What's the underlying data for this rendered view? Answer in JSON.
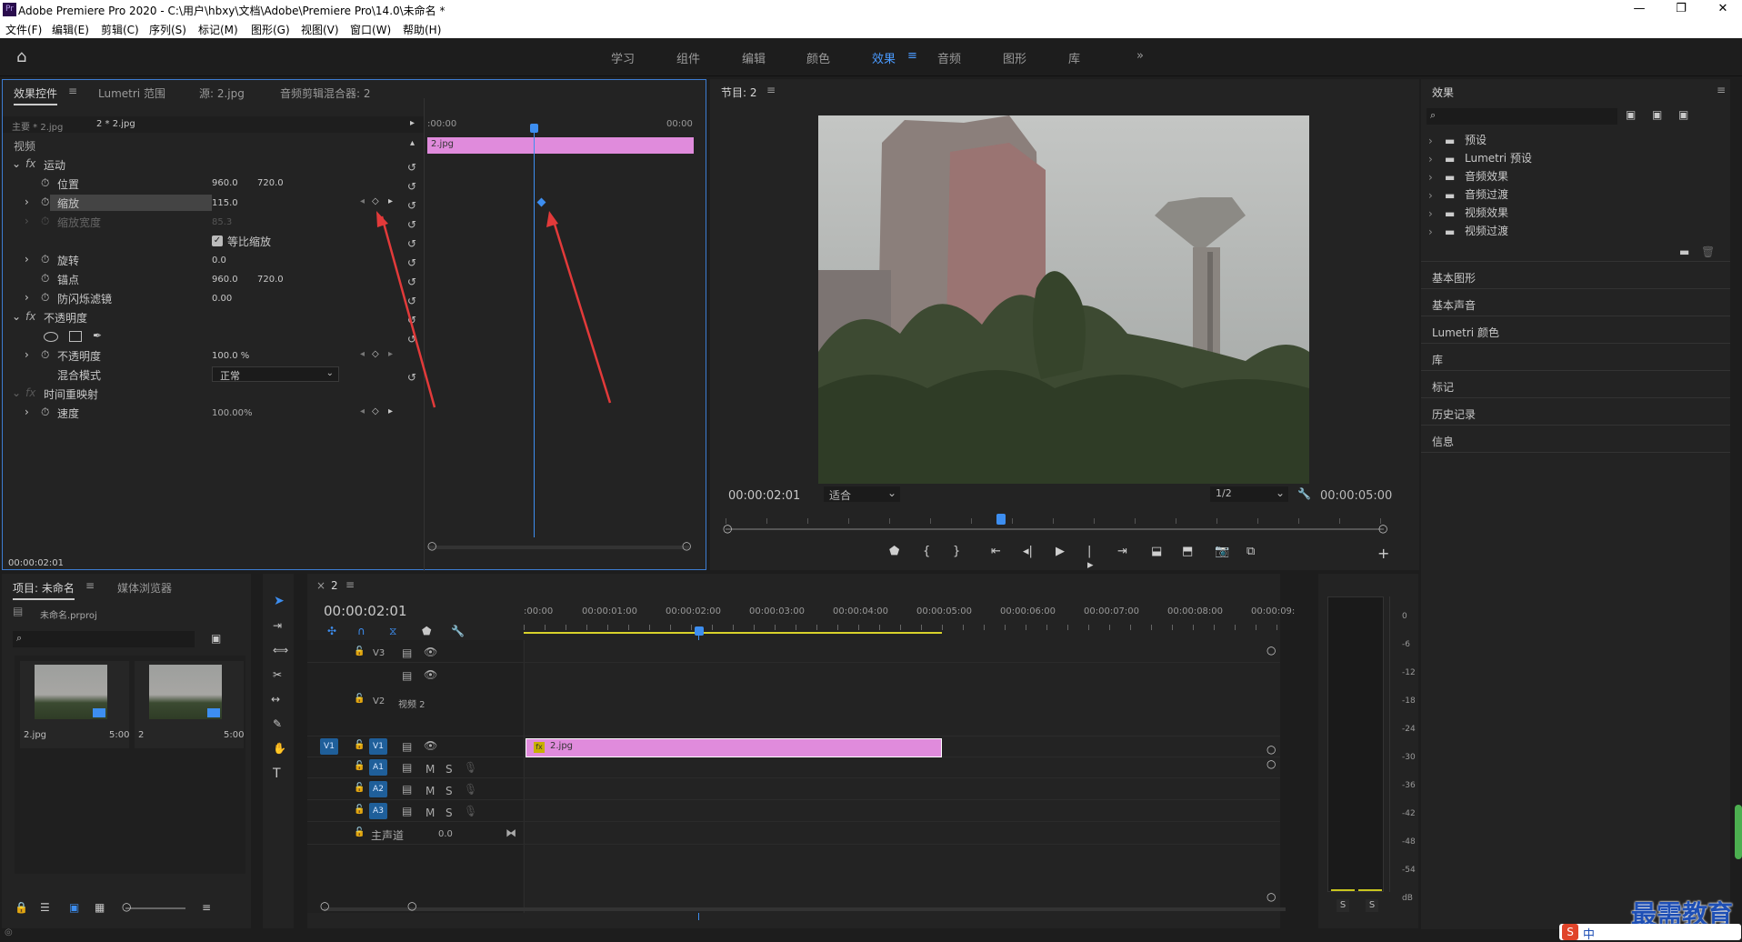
{
  "window": {
    "title": "Adobe Premiere Pro 2020 - C:\\用户\\hbxy\\文档\\Adobe\\Premiere Pro\\14.0\\未命名 *",
    "app_icon": "Pr"
  },
  "menu": [
    "文件(F)",
    "编辑(E)",
    "剪辑(C)",
    "序列(S)",
    "标记(M)",
    "图形(G)",
    "视图(V)",
    "窗口(W)",
    "帮助(H)"
  ],
  "workspaces": [
    "学习",
    "组件",
    "编辑",
    "颜色",
    "效果",
    "音频",
    "图形",
    "库"
  ],
  "effect_controls": {
    "tabs": [
      "效果控件",
      "Lumetri 范围",
      "源: 2.jpg",
      "音频剪辑混合器: 2"
    ],
    "source": "主要 * 2.jpg",
    "clip": "2 * 2.jpg",
    "video_label": "视频",
    "ruler_start": ":00:00",
    "ruler_end": "00:00",
    "clip_bar": "2.jpg",
    "motion": "运动",
    "position": "位置",
    "pos_x": "960.0",
    "pos_y": "720.0",
    "scale": "缩放",
    "scale_val": "115.0",
    "scale_w": "缩放宽度",
    "scale_w_val": "85.3",
    "uniform": "等比缩放",
    "rotation": "旋转",
    "rot_val": "0.0",
    "anchor": "锚点",
    "anc_x": "960.0",
    "anc_y": "720.0",
    "flicker": "防闪烁滤镜",
    "flicker_val": "0.00",
    "opacity_group": "不透明度",
    "opacity": "不透明度",
    "opacity_val": "100.0 %",
    "blend": "混合模式",
    "blend_val": "正常",
    "time_remap": "时间重映射",
    "speed": "速度",
    "speed_val": "100.00%",
    "timecode": "00:00:02:01"
  },
  "program": {
    "title": "节目: 2",
    "timecode": "00:00:02:01",
    "fit": "适合",
    "res": "1/2",
    "duration": "00:00:05:00"
  },
  "effects_panel": {
    "title": "效果",
    "items": [
      "预设",
      "Lumetri 预设",
      "音频效果",
      "音频过渡",
      "视频效果",
      "视频过渡"
    ],
    "panels": [
      "基本图形",
      "基本声音",
      "Lumetri 颜色",
      "库",
      "标记",
      "历史记录",
      "信息"
    ]
  },
  "project": {
    "tabs": [
      "项目: 未命名",
      "媒体浏览器"
    ],
    "file": "未命名.prproj",
    "items": [
      {
        "name": "2.jpg",
        "dur": "5:00"
      },
      {
        "name": "2",
        "dur": "5:00"
      }
    ]
  },
  "timeline": {
    "tab": "2",
    "timecode": "00:00:02:01",
    "ruler": [
      ":00:00",
      "00:00:01:00",
      "00:00:02:00",
      "00:00:03:00",
      "00:00:04:00",
      "00:00:05:00",
      "00:00:06:00",
      "00:00:07:00",
      "00:00:08:00",
      "00:00:09:"
    ],
    "tracks": {
      "v3": "V3",
      "v2": "V2",
      "v2_name": "视频 2",
      "v1": "V1",
      "v1_src": "V1",
      "a1": "A1",
      "a2": "A2",
      "a3": "A3",
      "master": "主声道",
      "master_val": "0.0"
    },
    "clip": "2.jpg"
  },
  "meter": {
    "scale": [
      "0",
      "-6",
      "-12",
      "-18",
      "-24",
      "-30",
      "-36",
      "-42",
      "-48",
      "-54",
      "dB"
    ],
    "solo": [
      "S",
      "S"
    ]
  },
  "watermark": "最需教育",
  "ime": "中"
}
